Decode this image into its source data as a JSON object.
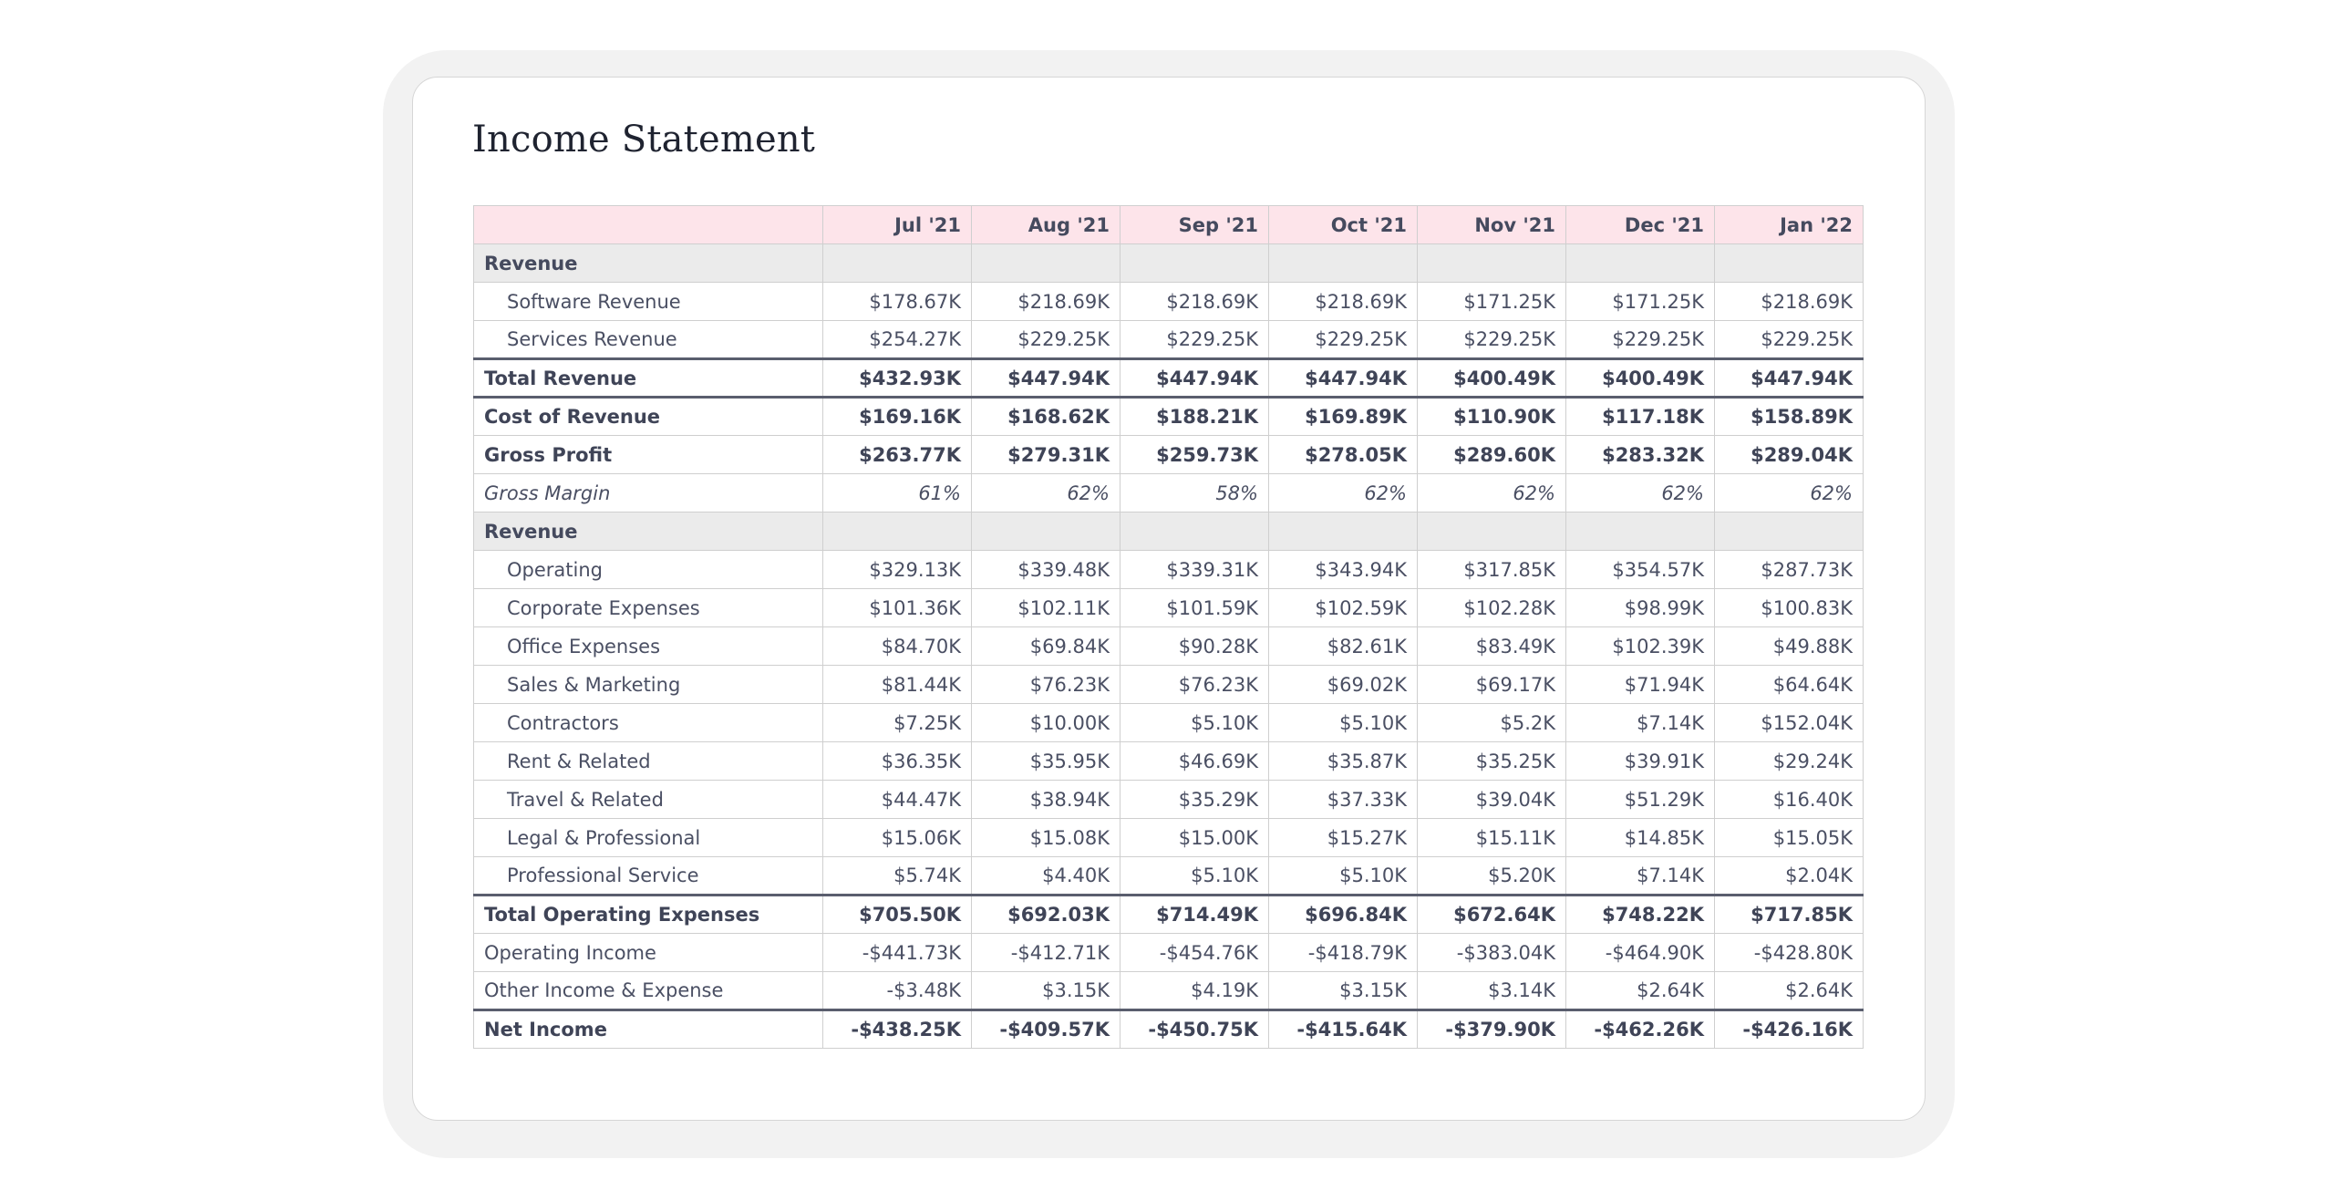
{
  "title": "Income Statement",
  "months": [
    "Jul '21",
    "Aug '21",
    "Sep '21",
    "Oct '21",
    "Nov '21",
    "Dec '21",
    "Jan '22"
  ],
  "rows": [
    {
      "label": "Revenue",
      "style": "section",
      "values": [
        "",
        "",
        "",
        "",
        "",
        "",
        ""
      ]
    },
    {
      "label": "Software Revenue",
      "style": "line",
      "values": [
        "$178.67K",
        "$218.69K",
        "$218.69K",
        "$218.69K",
        "$171.25K",
        "$171.25K",
        "$218.69K"
      ]
    },
    {
      "label": "Services Revenue",
      "style": "line",
      "values": [
        "$254.27K",
        "$229.25K",
        "$229.25K",
        "$229.25K",
        "$229.25K",
        "$229.25K",
        "$229.25K"
      ]
    },
    {
      "label": "Total Revenue",
      "style": "bold top-rule bottom-rule",
      "values": [
        "$432.93K",
        "$447.94K",
        "$447.94K",
        "$447.94K",
        "$400.49K",
        "$400.49K",
        "$447.94K"
      ]
    },
    {
      "label": "Cost of Revenue",
      "style": "bold",
      "values": [
        "$169.16K",
        "$168.62K",
        "$188.21K",
        "$169.89K",
        "$110.90K",
        "$117.18K",
        "$158.89K"
      ]
    },
    {
      "label": "Gross Profit",
      "style": "bold",
      "values": [
        "$263.77K",
        "$279.31K",
        "$259.73K",
        "$278.05K",
        "$289.60K",
        "$283.32K",
        "$289.04K"
      ]
    },
    {
      "label": "Gross Margin",
      "style": "italic",
      "values": [
        "61%",
        "62%",
        "58%",
        "62%",
        "62%",
        "62%",
        "62%"
      ]
    },
    {
      "label": "Revenue",
      "style": "section",
      "values": [
        "",
        "",
        "",
        "",
        "",
        "",
        ""
      ]
    },
    {
      "label": "Operating",
      "style": "line",
      "values": [
        "$329.13K",
        "$339.48K",
        "$339.31K",
        "$343.94K",
        "$317.85K",
        "$354.57K",
        "$287.73K"
      ]
    },
    {
      "label": "Corporate Expenses",
      "style": "line",
      "values": [
        "$101.36K",
        "$102.11K",
        "$101.59K",
        "$102.59K",
        "$102.28K",
        "$98.99K",
        "$100.83K"
      ]
    },
    {
      "label": "Office Expenses",
      "style": "line",
      "values": [
        "$84.70K",
        "$69.84K",
        "$90.28K",
        "$82.61K",
        "$83.49K",
        "$102.39K",
        "$49.88K"
      ]
    },
    {
      "label": "Sales & Marketing",
      "style": "line",
      "values": [
        "$81.44K",
        "$76.23K",
        "$76.23K",
        "$69.02K",
        "$69.17K",
        "$71.94K",
        "$64.64K"
      ]
    },
    {
      "label": "Contractors",
      "style": "line",
      "values": [
        "$7.25K",
        "$10.00K",
        "$5.10K",
        "$5.10K",
        "$5.2K",
        "$7.14K",
        "$152.04K"
      ]
    },
    {
      "label": "Rent & Related",
      "style": "line",
      "values": [
        "$36.35K",
        "$35.95K",
        "$46.69K",
        "$35.87K",
        "$35.25K",
        "$39.91K",
        "$29.24K"
      ]
    },
    {
      "label": "Travel & Related",
      "style": "line",
      "values": [
        "$44.47K",
        "$38.94K",
        "$35.29K",
        "$37.33K",
        "$39.04K",
        "$51.29K",
        "$16.40K"
      ]
    },
    {
      "label": "Legal & Professional",
      "style": "line",
      "values": [
        "$15.06K",
        "$15.08K",
        "$15.00K",
        "$15.27K",
        "$15.11K",
        "$14.85K",
        "$15.05K"
      ]
    },
    {
      "label": "Professional Service",
      "style": "line",
      "values": [
        "$5.74K",
        "$4.40K",
        "$5.10K",
        "$5.10K",
        "$5.20K",
        "$7.14K",
        "$2.04K"
      ]
    },
    {
      "label": "Total Operating Expenses",
      "style": "bold top-rule",
      "values": [
        "$705.50K",
        "$692.03K",
        "$714.49K",
        "$696.84K",
        "$672.64K",
        "$748.22K",
        "$717.85K"
      ]
    },
    {
      "label": "Operating Income",
      "style": "plain",
      "values": [
        "-$441.73K",
        "-$412.71K",
        "-$454.76K",
        "-$418.79K",
        "-$383.04K",
        "-$464.90K",
        "-$428.80K"
      ]
    },
    {
      "label": "Other Income & Expense",
      "style": "plain",
      "values": [
        "-$3.48K",
        "$3.15K",
        "$4.19K",
        "$3.15K",
        "$3.14K",
        "$2.64K",
        "$2.64K"
      ]
    },
    {
      "label": "Net Income",
      "style": "bold top-rule",
      "values": [
        "-$438.25K",
        "-$409.57K",
        "-$450.75K",
        "-$415.64K",
        "-$379.90K",
        "-$462.26K",
        "-$426.16K"
      ]
    }
  ]
}
